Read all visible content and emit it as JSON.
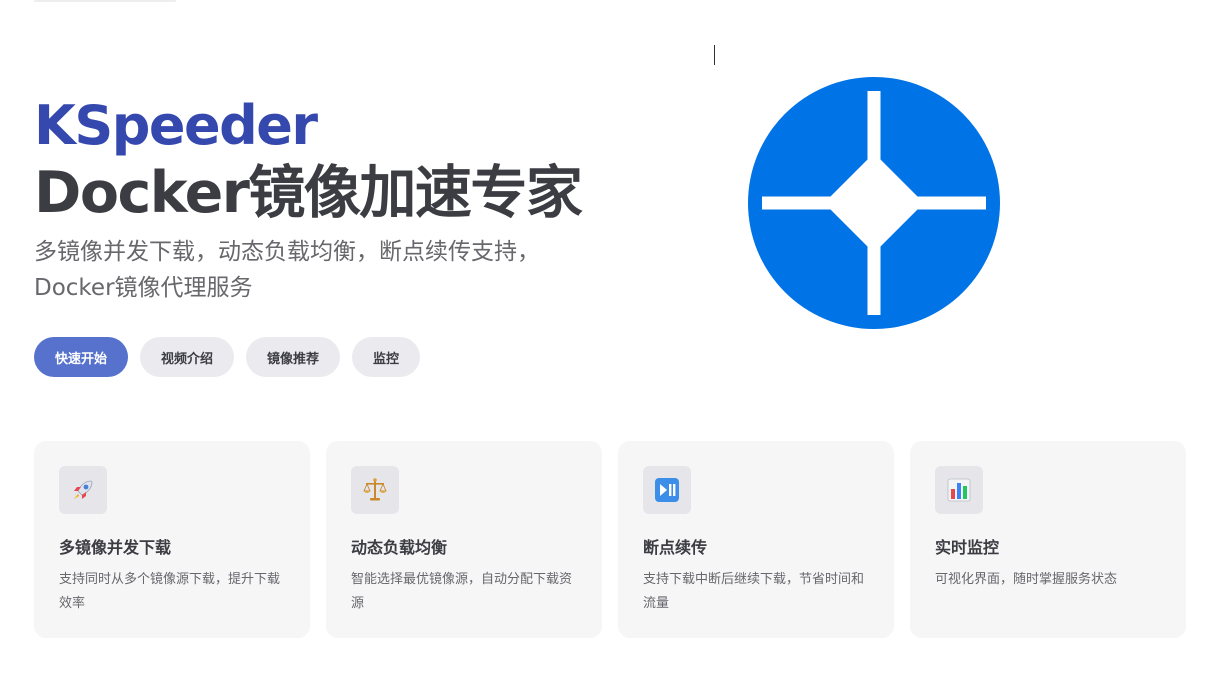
{
  "hero": {
    "brand": "KSpeeder",
    "headline": "Docker镜像加速专家",
    "tagline": "多镜像并发下载，动态负载均衡，断点续传支持，Docker镜像代理服务"
  },
  "actions": [
    {
      "label": "快速开始",
      "style": "primary"
    },
    {
      "label": "视频介绍",
      "style": "alt"
    },
    {
      "label": "镜像推荐",
      "style": "alt"
    },
    {
      "label": "监控",
      "style": "alt"
    }
  ],
  "logo": {
    "icon": "compass-cross-logo-icon",
    "color": "#0073e6"
  },
  "features": [
    {
      "icon": "rocket-icon",
      "title": "多镜像并发下载",
      "desc": "支持同时从多个镜像源下载，提升下载效率"
    },
    {
      "icon": "balance-scale-icon",
      "title": "动态负载均衡",
      "desc": "智能选择最优镜像源，自动分配下载资源"
    },
    {
      "icon": "play-pause-icon",
      "title": "断点续传",
      "desc": "支持下载中断后继续下载，节省时间和流量"
    },
    {
      "icon": "bar-chart-icon",
      "title": "实时监控",
      "desc": "可视化界面，随时掌握服务状态"
    }
  ],
  "colors": {
    "brand": "#3448ad",
    "primary_button": "#5672cd",
    "logo_blue": "#0073e6"
  }
}
